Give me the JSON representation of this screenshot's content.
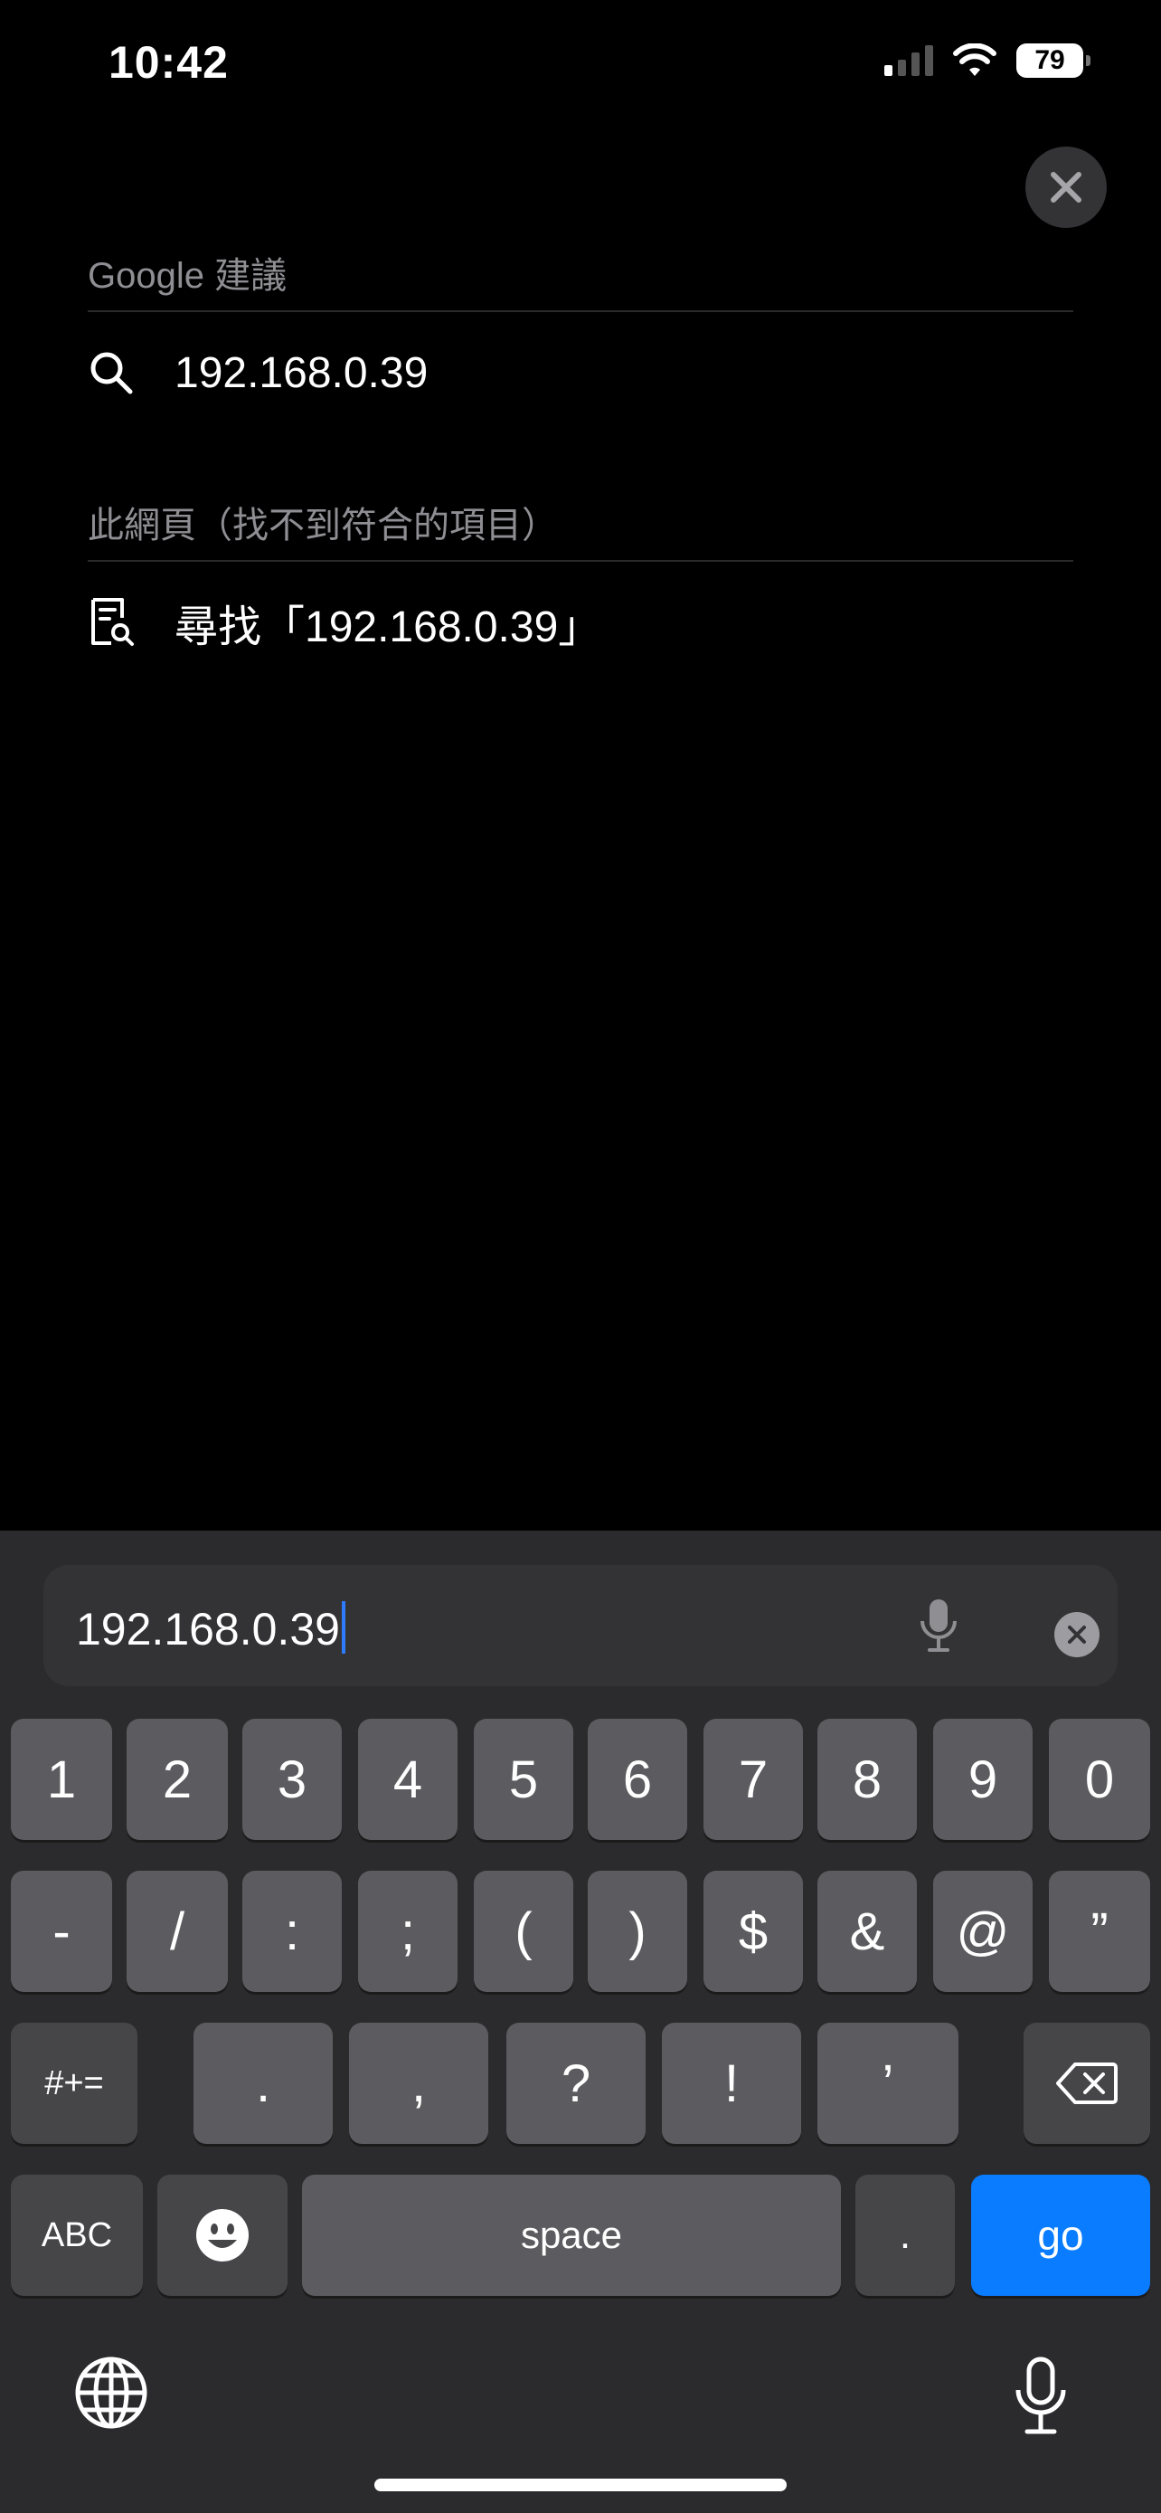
{
  "status_bar": {
    "time": "10:42",
    "battery": "79"
  },
  "suggestions": {
    "google_title": "Google 建議",
    "google_item": "192.168.0.39",
    "page_title": "此網頁（找不到符合的項目）",
    "page_item": "尋找「192.168.0.39」"
  },
  "address_bar": {
    "value": "192.168.0.39"
  },
  "keyboard": {
    "row1": [
      "1",
      "2",
      "3",
      "4",
      "5",
      "6",
      "7",
      "8",
      "9",
      "0"
    ],
    "row2": [
      "-",
      "/",
      ":",
      ";",
      "(",
      ")",
      "$",
      "&",
      "@",
      "”"
    ],
    "row3_left": "#+=",
    "row3": [
      ".",
      ",",
      "?",
      "!",
      "’"
    ],
    "abc": "ABC",
    "space": "space",
    "period": ".",
    "go": "go"
  },
  "colors": {
    "accent": "#0a7cff",
    "key": "#5c5c60",
    "key_dark": "#464649",
    "panel": "#2b2b2d"
  }
}
